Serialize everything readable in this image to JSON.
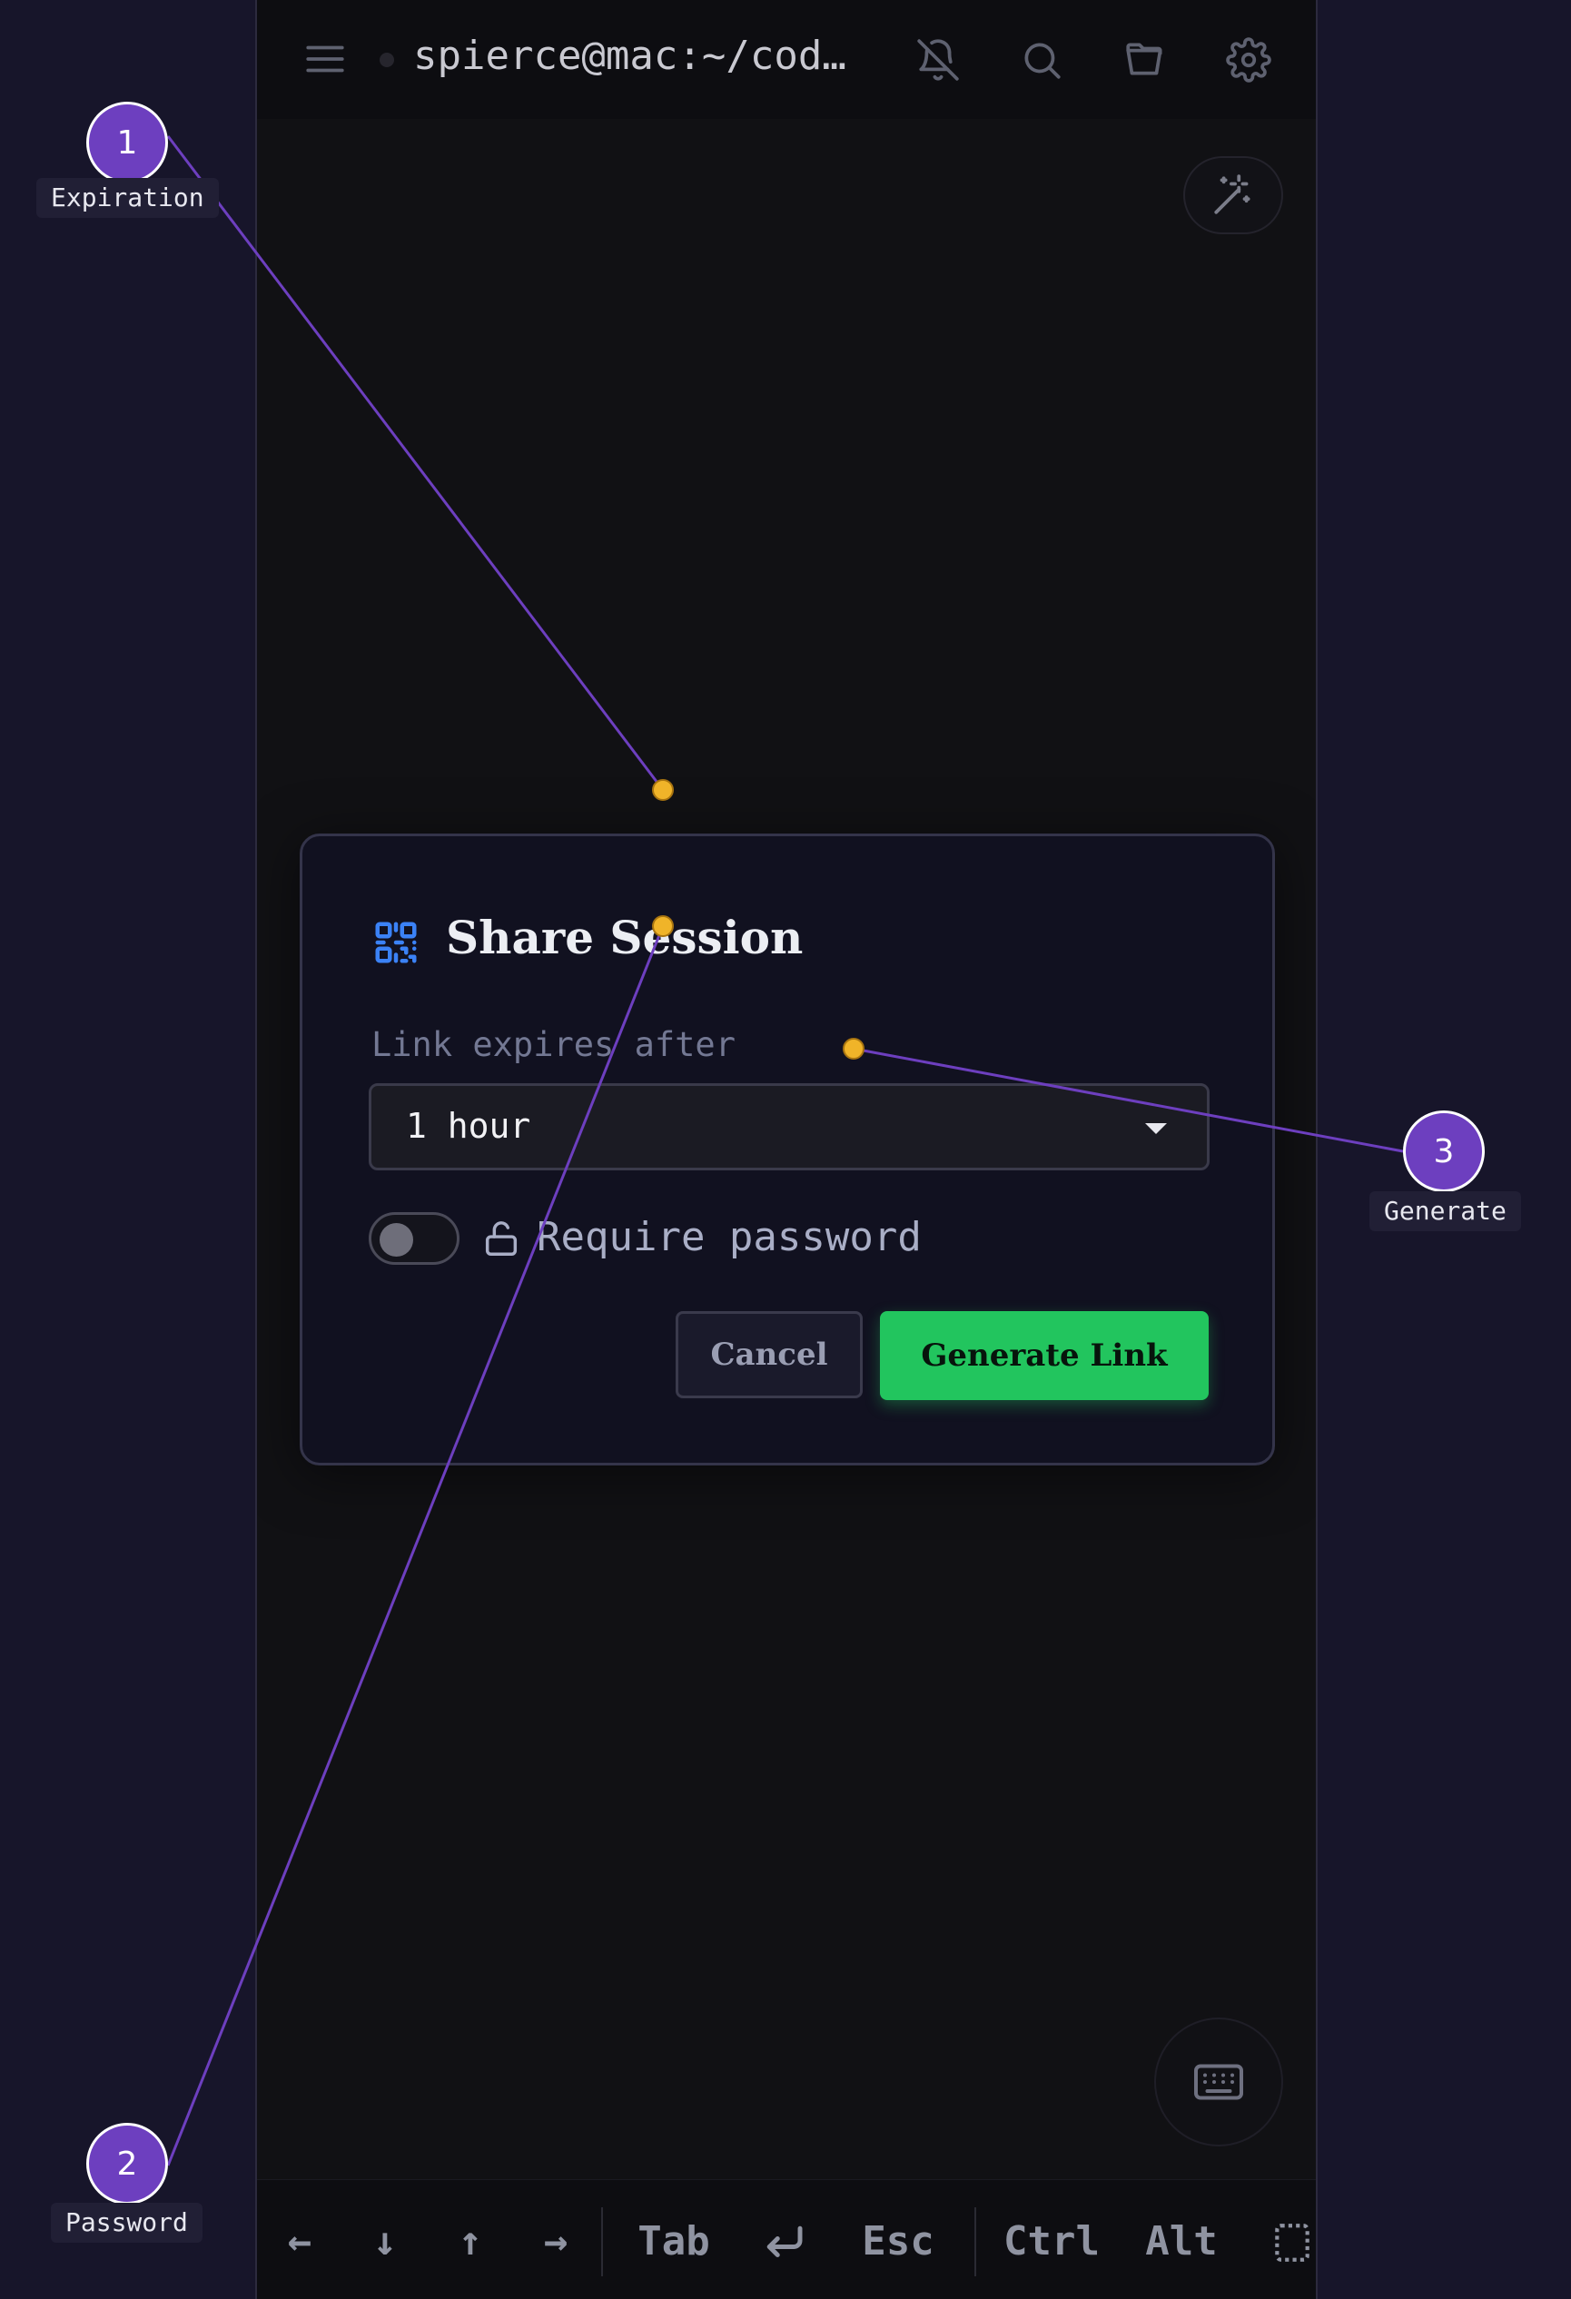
{
  "header": {
    "session_title": "spierce@mac:~/code/..."
  },
  "share_modal": {
    "title": "Share Session",
    "expiry_label": "Link expires after",
    "expiry_value": "1 hour",
    "password_label": "Require password",
    "password_enabled": false,
    "cancel_label": "Cancel",
    "generate_label": "Generate Link"
  },
  "keybar": {
    "left": "←",
    "down": "↓",
    "up": "↑",
    "right": "→",
    "tab": "Tab",
    "esc": "Esc",
    "ctrl": "Ctrl",
    "alt": "Alt"
  },
  "callouts": [
    {
      "number": "1",
      "label": "Expiration"
    },
    {
      "number": "2",
      "label": "Password"
    },
    {
      "number": "3",
      "label": "Generate"
    }
  ],
  "colors": {
    "accent_green": "#22c55e",
    "callout_purple": "#6d3fbf",
    "target_dot": "#f0b429",
    "qr_icon_blue": "#3b82f6"
  }
}
